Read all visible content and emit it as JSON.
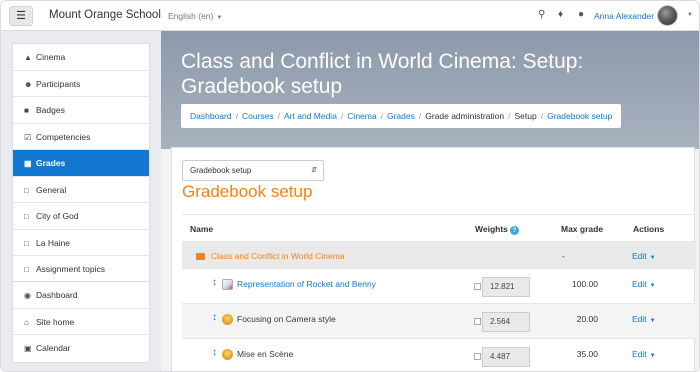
{
  "navbar": {
    "menu_icon": "hamburger-icon",
    "site_name": "Mount Orange School",
    "language": "English (en)",
    "user_name": "Anna Alexander"
  },
  "sidebar": {
    "course_items": [
      {
        "label": "Cinema",
        "icon": "graduation-cap-icon",
        "active": false
      },
      {
        "label": "Participants",
        "icon": "users-icon",
        "active": false
      },
      {
        "label": "Badges",
        "icon": "shield-icon",
        "active": false
      },
      {
        "label": "Competencies",
        "icon": "checkbox-icon",
        "active": false
      },
      {
        "label": "Grades",
        "icon": "table-icon",
        "active": true
      },
      {
        "label": "General",
        "icon": "folder-icon",
        "active": false
      },
      {
        "label": "City of God",
        "icon": "folder-icon",
        "active": false
      },
      {
        "label": "La Haine",
        "icon": "folder-icon",
        "active": false
      },
      {
        "label": "Assignment topics",
        "icon": "folder-icon",
        "active": false
      }
    ],
    "site_items": [
      {
        "label": "Dashboard",
        "icon": "dashboard-icon"
      },
      {
        "label": "Site home",
        "icon": "home-icon"
      },
      {
        "label": "Calendar",
        "icon": "calendar-icon"
      }
    ]
  },
  "header": {
    "title": "Class and Conflict in World Cinema: Setup: Gradebook setup",
    "breadcrumb": [
      "Dashboard",
      "Courses",
      "Art and Media",
      "Cinema",
      "Grades",
      "Grade administration",
      "Setup",
      "Gradebook setup"
    ]
  },
  "main": {
    "select_value": "Gradebook setup",
    "heading": "Gradebook setup",
    "columns": {
      "name": "Name",
      "weights": "Weights",
      "max_grade": "Max grade",
      "actions": "Actions"
    },
    "category": {
      "name": "Class and Conflict in World Cinema",
      "max_grade": "-",
      "action": "Edit"
    },
    "items": [
      {
        "name": "Representation of Rocket and Benny",
        "type": "assignment",
        "weight": "12.821",
        "max_grade": "100.00",
        "action": "Edit"
      },
      {
        "name": "Focusing on Camera style",
        "type": "quiz",
        "weight": "2.564",
        "max_grade": "20.00",
        "action": "Edit"
      },
      {
        "name": "Mise en Scène",
        "type": "quiz",
        "weight": "4.487",
        "max_grade": "35.00",
        "action": "Edit"
      }
    ]
  }
}
